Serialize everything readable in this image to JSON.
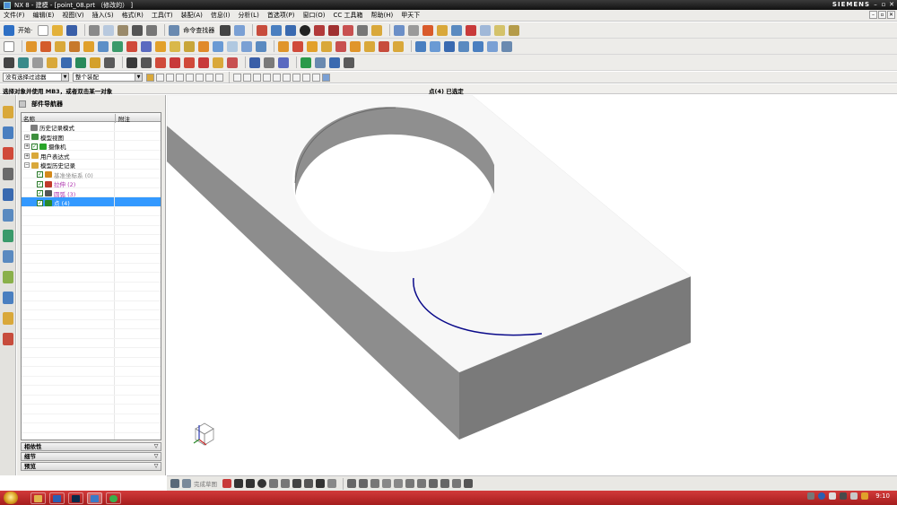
{
  "titlebar": {
    "title": "NX 8 - 建模 - [point_08.prt （修改的） ]",
    "brand": "SIEMENS",
    "min": "–",
    "restore": "▫",
    "close": "✕"
  },
  "menubar": {
    "items": [
      "文件(F)",
      "编辑(E)",
      "视图(V)",
      "插入(S)",
      "格式(R)",
      "工具(T)",
      "装配(A)",
      "信息(I)",
      "分析(L)",
      "首选项(P)",
      "窗口(O)",
      "CC 工具箱",
      "帮助(H)",
      "甲天下"
    ]
  },
  "toolbar": {
    "start_label": "开始·",
    "command_finder_label": "命令查找器"
  },
  "selection": {
    "filter_value": "没有选择过滤器",
    "scope_value": "整个装配"
  },
  "cue": {
    "prompt": "选择对象并使用 MB3，或者双击某一对象",
    "status": "点(4) 已选定"
  },
  "navigator": {
    "title": "部件导航器",
    "columns": [
      "名称",
      "附注"
    ],
    "nodes": [
      {
        "label": "历史记录模式",
        "depth": 1,
        "expander": "",
        "icon_color": "#7c7c7c",
        "check": "",
        "label_color": "#000000"
      },
      {
        "label": "模型视图",
        "depth": 0,
        "expander": "+",
        "icon_color": "#3d8f3d",
        "check": "",
        "label_color": "#000000"
      },
      {
        "label": "摄像机",
        "depth": 0,
        "expander": "+",
        "icon_color": "#2aa52a",
        "check": "✓",
        "label_color": "#000000"
      },
      {
        "label": "用户表达式",
        "depth": 0,
        "expander": "+",
        "icon_color": "#d9a83a",
        "check": "",
        "label_color": "#000000"
      },
      {
        "label": "模型历史记录",
        "depth": 0,
        "expander": "−",
        "icon_color": "#d9a83a",
        "check": "",
        "label_color": "#000000"
      },
      {
        "label": "基准坐标系 (0)",
        "depth": 2,
        "expander": "",
        "icon_color": "#d4891b",
        "check": "✓",
        "label_color": "#8a8a8a"
      },
      {
        "label": "拉伸 (2)",
        "depth": 2,
        "expander": "",
        "icon_color": "#c0392b",
        "check": "✓",
        "label_color": "#b03ab0"
      },
      {
        "label": "圆弧 (3)",
        "depth": 2,
        "expander": "",
        "icon_color": "#555555",
        "check": "✓",
        "label_color": "#b03ab0"
      },
      {
        "label": "点 (4)",
        "depth": 2,
        "expander": "",
        "icon_color": "#2a8a2a",
        "check": "✓",
        "label_color": "#ffffff"
      }
    ],
    "panels": [
      "相依性",
      "细节",
      "预览"
    ]
  },
  "sketchbar": {
    "finish_label": "完成草图"
  },
  "taskbar": {
    "clock": "9:10"
  },
  "colors": {
    "accent_selection": "#3399ff",
    "taskbar": "#c42c2c",
    "solid_top": "#f5f5f5",
    "solid_front": "#7a7a7a",
    "solid_side": "#9a9a9a",
    "arc": "#0a0a8a"
  }
}
